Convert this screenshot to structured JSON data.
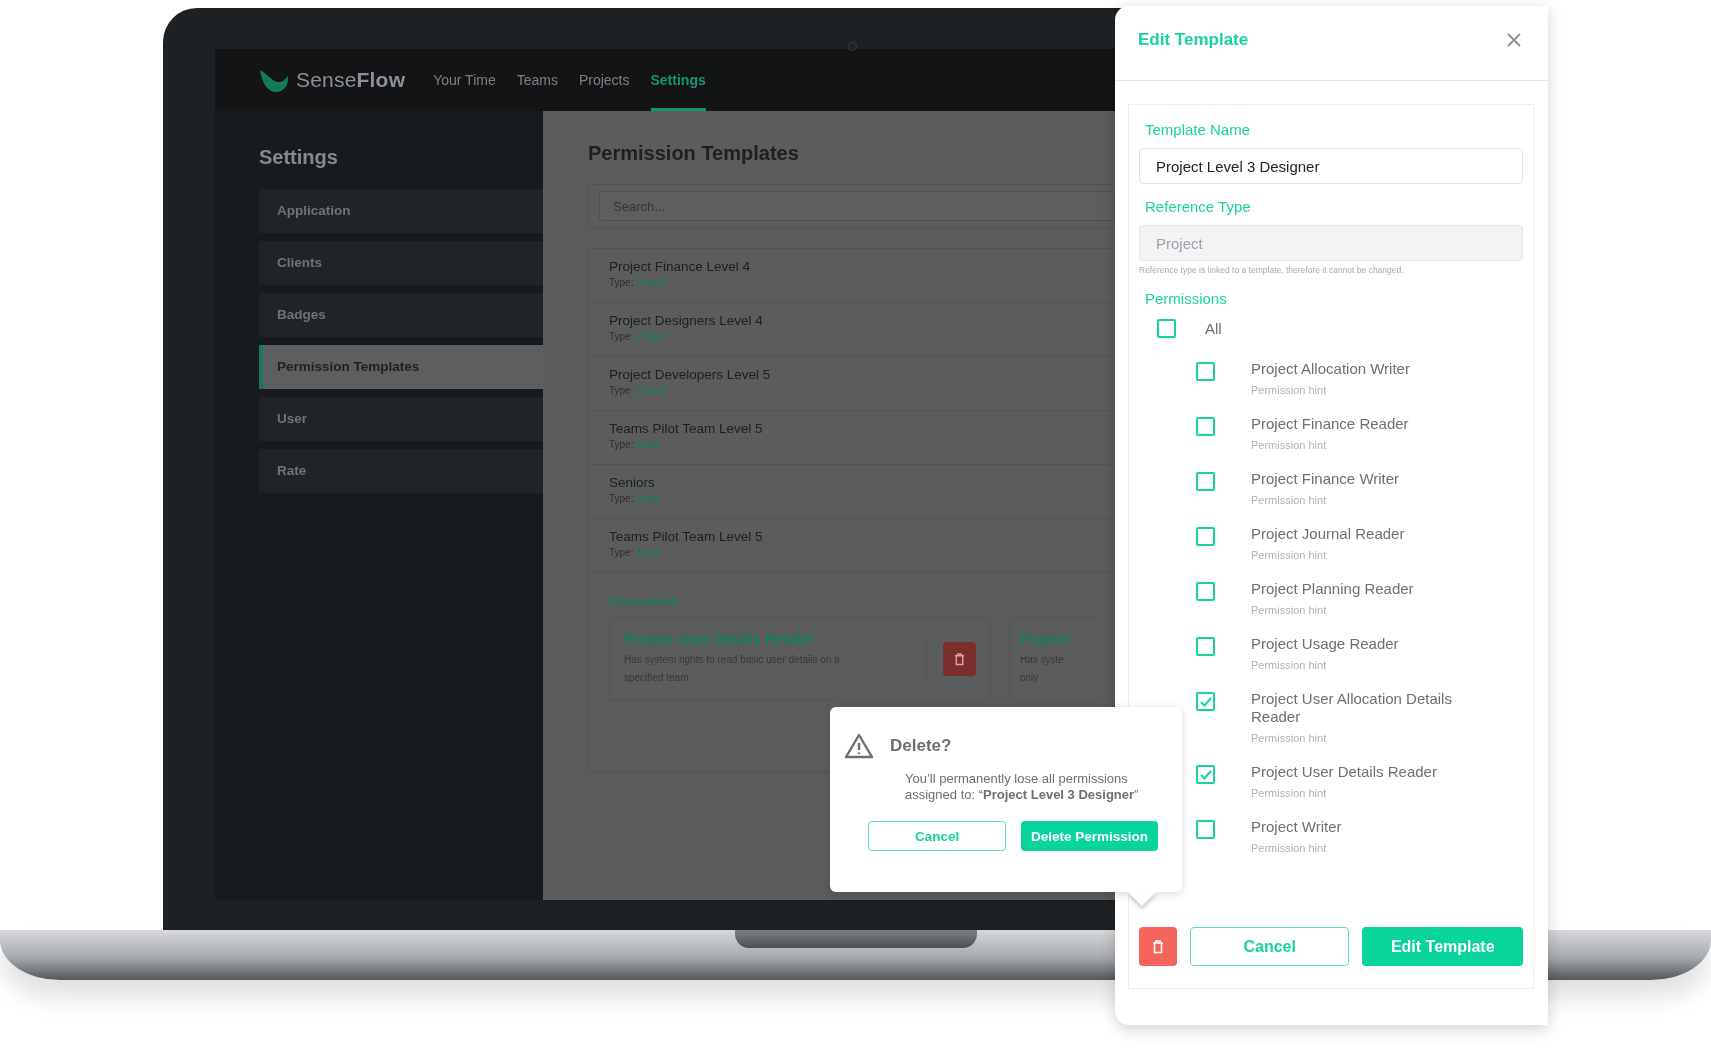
{
  "app": {
    "logo": "Sense**Flow**",
    "nav": [
      {
        "label": "Your Time",
        "selected": false
      },
      {
        "label": "Teams",
        "selected": false
      },
      {
        "label": "Projects",
        "selected": false
      },
      {
        "label": "Settings",
        "selected": true
      }
    ]
  },
  "sidebar": {
    "title": "Settings",
    "items": [
      {
        "label": "Application",
        "selected": false
      },
      {
        "label": "Clients",
        "selected": false
      },
      {
        "label": "Badges",
        "selected": false
      },
      {
        "label": "Permission Templates",
        "selected": true
      },
      {
        "label": "User",
        "selected": false
      },
      {
        "label": "Rate",
        "selected": false
      }
    ]
  },
  "main": {
    "title": "Permission Templates",
    "search": {
      "placeholder": "Search..."
    },
    "templates": [
      {
        "name": "Project Finance Level 4",
        "type_label": "Type:",
        "type": "Project"
      },
      {
        "name": "Project Designers Level 4",
        "type_label": "Type:",
        "type": "Project"
      },
      {
        "name": "Project Developers Level 5",
        "type_label": "Type:",
        "type": "Project"
      },
      {
        "name": "Teams Pilot Team Level 5",
        "type_label": "Type:",
        "type": "Team"
      },
      {
        "name": "Seniors",
        "type_label": "Type:",
        "type": "Team"
      },
      {
        "name": "Teams Pilot Team Level 5",
        "type_label": "Type:",
        "type": "Team"
      }
    ],
    "permissions_label": "Permissions",
    "permission_cards": [
      {
        "title": "Project User Details Reader",
        "description_lines": [
          "Has system rights to read basic user details on a",
          "specified team."
        ],
        "deletable": true
      },
      {
        "title": "Project",
        "description_lines": [
          "Has syste",
          "only"
        ]
      }
    ]
  },
  "delete_dialog": {
    "title": "Delete?",
    "message": "You’ll permanently lose all permissions assigned to: “**Project Level 3 Designer**”",
    "cancel": "Cancel",
    "confirm": "Delete Permission"
  },
  "edit_panel": {
    "title": "Edit Template",
    "template_name": {
      "label": "Template Name",
      "value": "Project Level 3 Designer"
    },
    "reference_type": {
      "label": "Reference Type",
      "value": "Project",
      "disabled": true,
      "hint": "Reference type is linked to a template, therefore it cannot be changed."
    },
    "permissions": {
      "label": "Permissions",
      "all": {
        "label": "All",
        "checked": false
      },
      "items": [
        {
          "name": "Project Allocation Writer",
          "hint": "Permission hint",
          "checked": false
        },
        {
          "name": "Project Finance Reader",
          "hint": "Permission hint",
          "checked": false
        },
        {
          "name": "Project Finance Writer",
          "hint": "Permission hint",
          "checked": false
        },
        {
          "name": "Project Journal Reader",
          "hint": "Permission hint",
          "checked": false
        },
        {
          "name": "Project Planning Reader",
          "hint": "Permission hint",
          "checked": false
        },
        {
          "name": "Project Usage Reader",
          "hint": "Permission hint",
          "checked": false
        },
        {
          "name": "Project User Allocation Details Reader",
          "hint": "Permission hint",
          "checked": true
        },
        {
          "name": "Project User Details Reader",
          "hint": "Permission hint",
          "checked": true
        },
        {
          "name": "Project Writer",
          "hint": "Permission hint",
          "checked": false
        }
      ]
    },
    "cancel": "Cancel",
    "submit": "Edit Template"
  }
}
